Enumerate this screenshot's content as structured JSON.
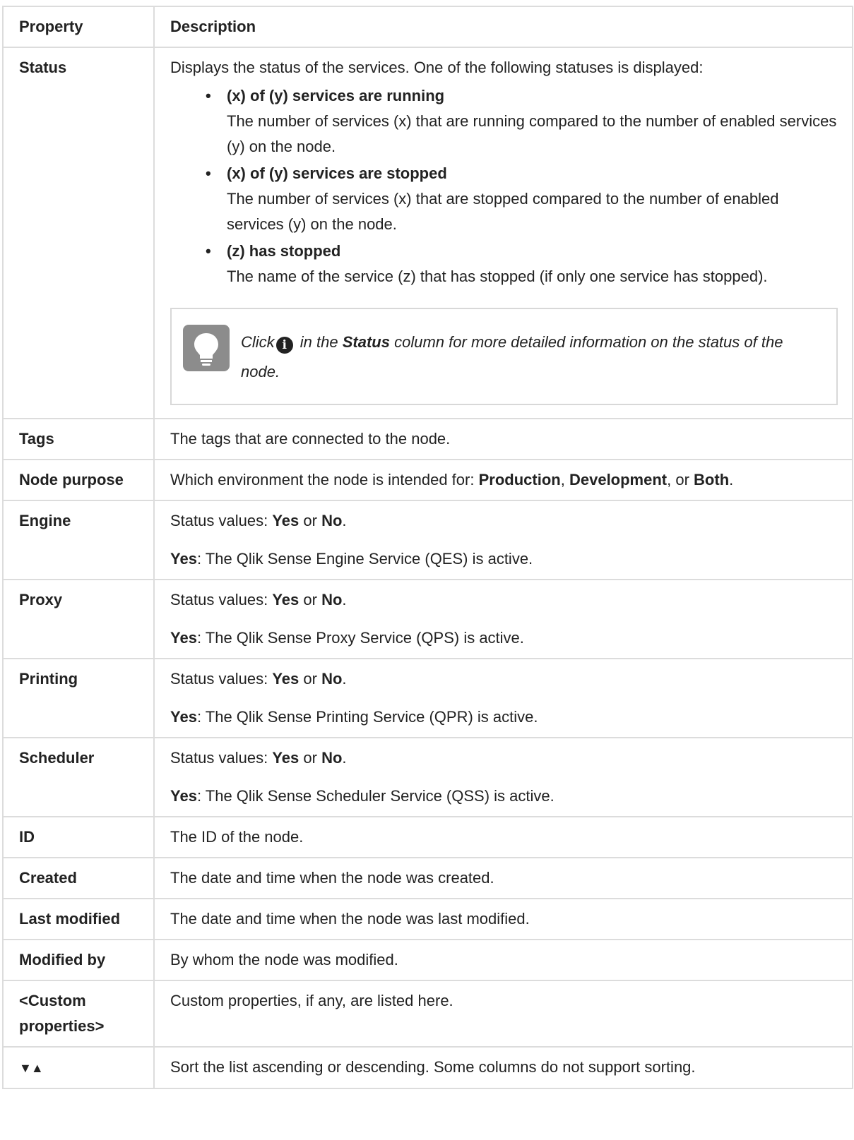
{
  "header": {
    "property": "Property",
    "description": "Description"
  },
  "status": {
    "label": "Status",
    "intro": "Displays the status of the services. One of the following statuses is displayed:",
    "items": [
      {
        "title": "(x) of (y) services are running",
        "text": "The number of services (x) that are running compared to the number of enabled services (y) on the node."
      },
      {
        "title": "(x) of (y) services are stopped",
        "text": "The number of services (x) that are stopped compared to the number of enabled services (y) on the node."
      },
      {
        "title": "(z) has stopped",
        "text": "The name of the service (z) that has stopped (if only one service has stopped)."
      }
    ],
    "tip": {
      "icon": "lightbulb-icon",
      "pre": "Click",
      "info_icon": "info-icon",
      "mid": "in the",
      "bold": "Status",
      "post": "column for more detailed information on the status of the node."
    }
  },
  "tags": {
    "label": "Tags",
    "text": "The tags that are connected to the node."
  },
  "node_purpose": {
    "label": "Node purpose",
    "pre": "Which environment the node is intended for:",
    "opt1": "Production",
    "sep1": ",",
    "opt2": "Development",
    "sep2": ", or",
    "opt3": "Both",
    "end": "."
  },
  "services": [
    {
      "label": "Engine",
      "values_pre": "Status values:",
      "yes": "Yes",
      "or": "or",
      "no": "No",
      "dot": ".",
      "yes_label": "Yes",
      "desc": ": The Qlik Sense Engine Service (QES) is active."
    },
    {
      "label": "Proxy",
      "values_pre": "Status values:",
      "yes": "Yes",
      "or": "or",
      "no": "No",
      "dot": ".",
      "yes_label": "Yes",
      "desc": ": The Qlik Sense Proxy Service (QPS) is active."
    },
    {
      "label": "Printing",
      "values_pre": "Status values:",
      "yes": "Yes",
      "or": "or",
      "no": "No",
      "dot": ".",
      "yes_label": "Yes",
      "desc": ": The Qlik Sense Printing Service (QPR) is active."
    },
    {
      "label": "Scheduler",
      "values_pre": "Status values:",
      "yes": "Yes",
      "or": "or",
      "no": "No",
      "dot": ".",
      "yes_label": "Yes",
      "desc": ": The Qlik Sense Scheduler Service (QSS) is active."
    }
  ],
  "simple_rows": [
    {
      "label": "ID",
      "text": "The ID of the node."
    },
    {
      "label": "Created",
      "text": "The date and time when the node was created."
    },
    {
      "label": "Last modified",
      "text": "The date and time when the node was last modified."
    },
    {
      "label": "Modified by",
      "text": "By whom the node was modified."
    },
    {
      "label": "<Custom properties>",
      "text": "Custom properties, if any, are listed here."
    }
  ],
  "sort": {
    "icons": "▼▲",
    "text": "Sort the list ascending or descending. Some columns do not support sorting."
  }
}
